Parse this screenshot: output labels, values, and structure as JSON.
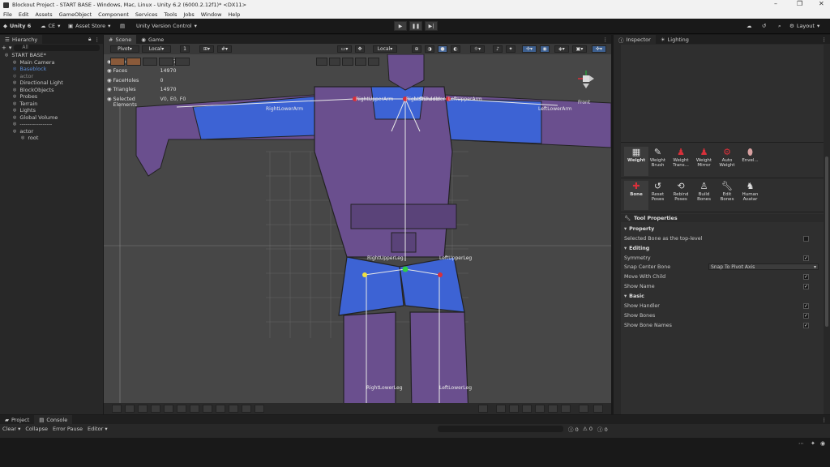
{
  "window": {
    "title": "Blockout Project - START BASE - Windows, Mac, Linux - Unity 6.2 (6000.2.12f1)* <DX11>"
  },
  "menu": [
    "File",
    "Edit",
    "Assets",
    "GameObject",
    "Component",
    "Services",
    "Tools",
    "Jobs",
    "Window",
    "Help"
  ],
  "toolbar": {
    "account": "Unity 6",
    "cloud": "CE",
    "asset_store": "Asset Store",
    "version_control": "Unity Version Control",
    "layout": "Layout"
  },
  "hierarchy": {
    "tab": "Hierarchy",
    "search_placeholder": "All",
    "items": [
      {
        "label": "START BASE*",
        "indent": 0
      },
      {
        "label": "Main Camera",
        "indent": 1
      },
      {
        "label": "Baseblock",
        "indent": 1
      },
      {
        "label": "actor",
        "indent": 1
      },
      {
        "label": "Directional Light",
        "indent": 1
      },
      {
        "label": "BlockObjects",
        "indent": 1
      },
      {
        "label": "Probes",
        "indent": 1
      },
      {
        "label": "Terrain",
        "indent": 1
      },
      {
        "label": "Lights",
        "indent": 1
      },
      {
        "label": "Global Volume",
        "indent": 1
      },
      {
        "label": "-----------------",
        "indent": 1
      },
      {
        "label": "actor",
        "indent": 1
      },
      {
        "label": "root",
        "indent": 2
      }
    ]
  },
  "scene": {
    "tabs": [
      "Scene",
      "Game"
    ],
    "pivot": "Pivot",
    "space": "Local",
    "snap_value": "1",
    "space2": "Local",
    "stats": [
      {
        "key": "Vertices",
        "value": "7486"
      },
      {
        "key": "Edges",
        "value": "22457"
      },
      {
        "key": "Faces",
        "value": "14970"
      },
      {
        "key": "FaceHoles",
        "value": "0"
      },
      {
        "key": "Triangles",
        "value": "14970"
      },
      {
        "key": "Selected Elements",
        "value": "V0, E0, F0"
      }
    ],
    "bones": [
      "RightLowerArm",
      "RightUpperArm",
      "RightShoulder",
      "LeftShoulder",
      "LeftUpperArm",
      "LeftLowerArm",
      "RightUpperLeg",
      "LeftUpperLeg",
      "RightLowerLeg",
      "LeftLowerLeg"
    ],
    "gizmo_label": "Front"
  },
  "inspector": {
    "tabs": [
      "Inspector",
      "Lighting"
    ],
    "weight_tools": [
      {
        "label": "Weight",
        "icon": "weight-icon"
      },
      {
        "label": "Weight Brush",
        "icon": "brush-icon"
      },
      {
        "label": "Weight Trans...",
        "icon": "figure-icon"
      },
      {
        "label": "Weight Mirror",
        "icon": "figure-icon"
      },
      {
        "label": "Auto Weight",
        "icon": "auto-icon"
      },
      {
        "label": "Envel...",
        "icon": "capsule-icon"
      }
    ],
    "bone_tools": [
      {
        "label": "Bone",
        "icon": "bone-icon"
      },
      {
        "label": "Reset Poses",
        "icon": "reset-icon"
      },
      {
        "label": "Rebind Poses",
        "icon": "rebind-icon"
      },
      {
        "label": "Build Bones",
        "icon": "build-icon"
      },
      {
        "label": "Edit Bones",
        "icon": "wrench-icon"
      },
      {
        "label": "Human Avatar",
        "icon": "avatar-icon"
      }
    ],
    "tool_properties": "Tool Properties",
    "property_header": "Property",
    "selected_bone_top": "Selected Bone as the top-level",
    "editing_header": "Editing",
    "symmetry": "Symmetry",
    "snap_center_bone": "Snap Center Bone",
    "snap_value": "Snap To Pivot Axis",
    "move_with_child": "Move With Child",
    "show_name": "Show Name",
    "basic_header": "Basic",
    "show_handler": "Show Handler",
    "show_bones": "Show Bones",
    "show_bone_names": "Show Bone Names"
  },
  "bottom": {
    "tabs": [
      "Project",
      "Console"
    ],
    "console_buttons": [
      "Clear",
      "Collapse",
      "Error Pause",
      "Editor"
    ],
    "counts": [
      "0",
      "0",
      "0"
    ]
  },
  "colors": {
    "accent_red": "#d8303a",
    "bone_yellow": "#f0e040",
    "bone_green": "#30d040",
    "cloth_blue": "#3d63d4",
    "cloth_purple": "#6a4f8e"
  }
}
